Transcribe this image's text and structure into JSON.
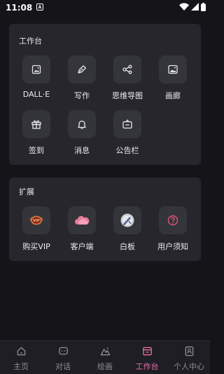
{
  "status_bar": {
    "time": "11:08",
    "notification_icon": "a-badge-icon",
    "wifi_icon": "wifi-icon",
    "signal_icon": "signal-icon",
    "battery_icon": "battery-icon"
  },
  "workbench": {
    "title": "工作台",
    "items": [
      {
        "label": "DALL·E",
        "icon": "image-icon"
      },
      {
        "label": "写作",
        "icon": "pen-icon"
      },
      {
        "label": "思维导图",
        "icon": "mindmap-icon"
      },
      {
        "label": "画廊",
        "icon": "gallery-icon"
      },
      {
        "label": "签到",
        "icon": "gift-icon"
      },
      {
        "label": "消息",
        "icon": "bell-icon"
      },
      {
        "label": "公告栏",
        "icon": "billboard-icon"
      }
    ]
  },
  "extensions": {
    "title": "扩展",
    "items": [
      {
        "label": "购买VIP",
        "icon": "vip-badge-icon"
      },
      {
        "label": "客户端",
        "icon": "cloud-icon"
      },
      {
        "label": "白板",
        "icon": "whiteboard-icon"
      },
      {
        "label": "用户须知",
        "icon": "question-icon"
      }
    ]
  },
  "tab_bar": {
    "active": "工作台",
    "accent_color": "#ec6fa8",
    "tabs": [
      {
        "label": "主页",
        "icon": "home-icon"
      },
      {
        "label": "对话",
        "icon": "chat-icon"
      },
      {
        "label": "绘画",
        "icon": "mountain-icon"
      },
      {
        "label": "工作台",
        "icon": "workbench-icon"
      },
      {
        "label": "个人中心",
        "icon": "profile-icon"
      }
    ]
  }
}
